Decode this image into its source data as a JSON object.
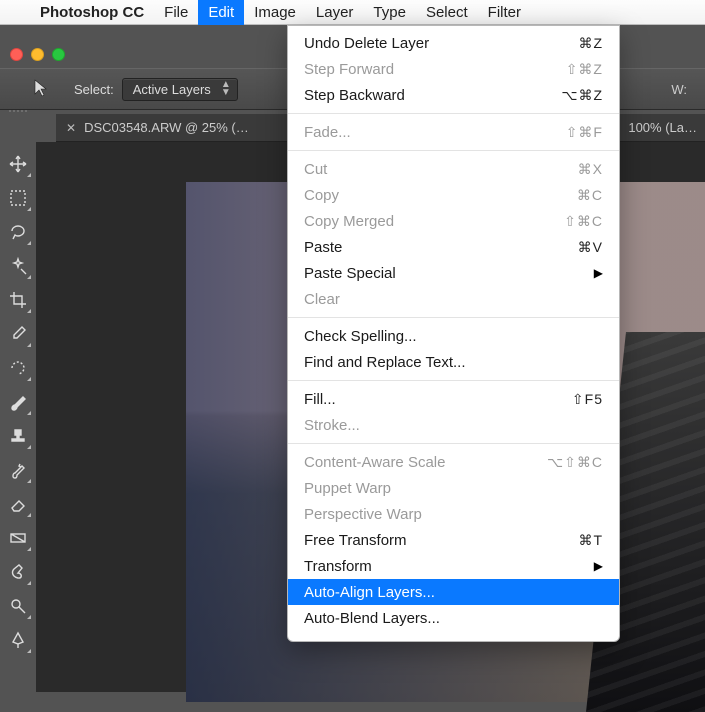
{
  "menubar": {
    "app": "Photoshop CC",
    "items": [
      "File",
      "Edit",
      "Image",
      "Layer",
      "Type",
      "Select",
      "Filter"
    ],
    "active_index": 1
  },
  "toolbar": {
    "select_label": "Select:",
    "dropdown_value": "Active Layers",
    "w_label": "W:"
  },
  "tabs": {
    "primary": "DSC03548.ARW @ 25% (…",
    "secondary": "100% (La…"
  },
  "tools": [
    "move-tool",
    "marquee-tool",
    "lasso-tool",
    "magic-wand-tool",
    "crop-tool",
    "eyedropper-tool",
    "patch-tool",
    "brush-tool",
    "stamp-tool",
    "history-brush-tool",
    "eraser-tool",
    "gradient-tool",
    "smudge-tool",
    "dodge-tool",
    "pen-tool"
  ],
  "edit_menu": [
    {
      "label": "Undo Delete Layer",
      "shortcut": "⌘Z"
    },
    {
      "label": "Step Forward",
      "shortcut": "⇧⌘Z",
      "disabled": true
    },
    {
      "label": "Step Backward",
      "shortcut": "⌥⌘Z"
    },
    {
      "sep": true
    },
    {
      "label": "Fade...",
      "shortcut": "⇧⌘F",
      "disabled": true
    },
    {
      "sep": true
    },
    {
      "label": "Cut",
      "shortcut": "⌘X",
      "disabled": true
    },
    {
      "label": "Copy",
      "shortcut": "⌘C",
      "disabled": true
    },
    {
      "label": "Copy Merged",
      "shortcut": "⇧⌘C",
      "disabled": true
    },
    {
      "label": "Paste",
      "shortcut": "⌘V"
    },
    {
      "label": "Paste Special",
      "submenu": true
    },
    {
      "label": "Clear",
      "disabled": true
    },
    {
      "sep": true
    },
    {
      "label": "Check Spelling..."
    },
    {
      "label": "Find and Replace Text..."
    },
    {
      "sep": true
    },
    {
      "label": "Fill...",
      "shortcut": "⇧F5"
    },
    {
      "label": "Stroke...",
      "disabled": true
    },
    {
      "sep": true
    },
    {
      "label": "Content-Aware Scale",
      "shortcut": "⌥⇧⌘C",
      "disabled": true
    },
    {
      "label": "Puppet Warp",
      "disabled": true
    },
    {
      "label": "Perspective Warp",
      "disabled": true
    },
    {
      "label": "Free Transform",
      "shortcut": "⌘T"
    },
    {
      "label": "Transform",
      "submenu": true
    },
    {
      "label": "Auto-Align Layers...",
      "highlight": true
    },
    {
      "label": "Auto-Blend Layers..."
    }
  ]
}
